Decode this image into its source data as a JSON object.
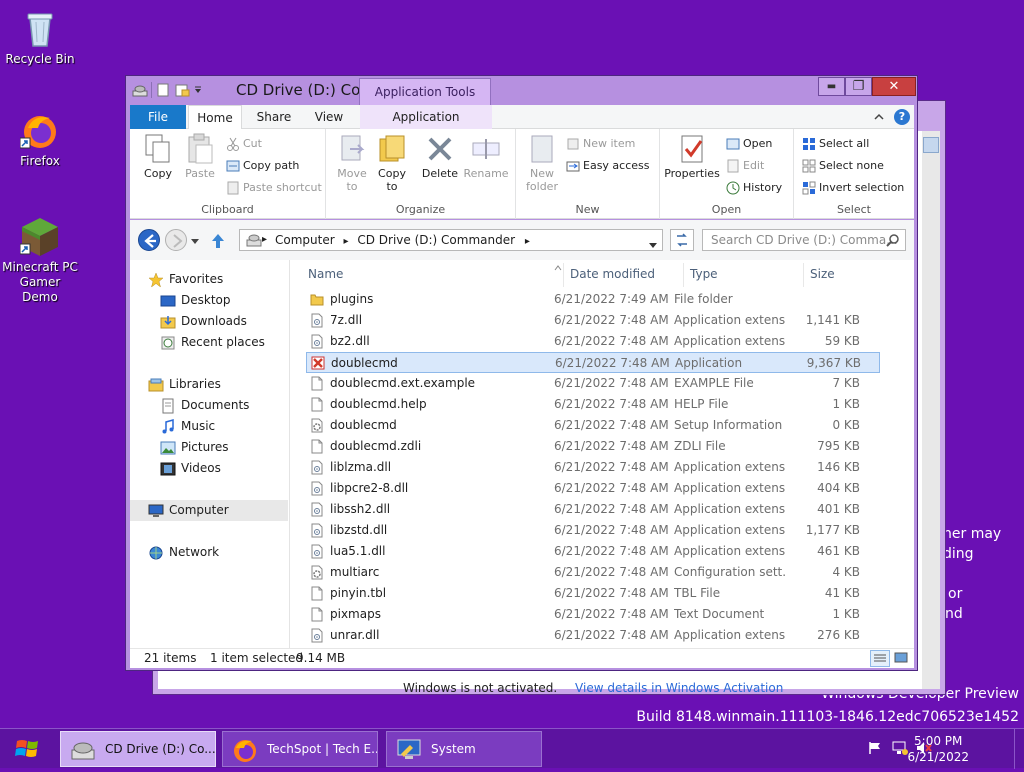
{
  "desktop": {
    "icons": [
      {
        "label": "Recycle Bin"
      },
      {
        "label": "Firefox"
      },
      {
        "label": "Minecraft PC Gamer Demo"
      }
    ],
    "watermark": {
      "partial_1": "ner may",
      "partial_2": "ding",
      "partial_3": "or",
      "partial_4": "nd",
      "line1": "Windows Developer Preview",
      "line2": "Build 8148.winmain.111103-1846.12edc706523e1452"
    }
  },
  "back_window": {
    "activation_text": "Windows is not activated.",
    "activation_link": "View details in Windows Activation"
  },
  "explorer": {
    "title": "CD Drive (D:) Co...",
    "context_tab": "Application Tools",
    "window_controls": {
      "minimize": "▬",
      "maximize": "❐",
      "close": "✕"
    },
    "tabs": {
      "file": "File",
      "home": "Home",
      "share": "Share",
      "view": "View",
      "application": "Application"
    },
    "ribbon": {
      "clipboard": {
        "label": "Clipboard",
        "copy": "Copy",
        "paste": "Paste",
        "cut": "Cut",
        "copy_path": "Copy path",
        "paste_shortcut": "Paste shortcut"
      },
      "organize": {
        "label": "Organize",
        "move_to": "Move to",
        "copy_to": "Copy to",
        "delete": "Delete",
        "rename": "Rename"
      },
      "new": {
        "label": "New",
        "new_folder": "New folder",
        "new_item": "New item",
        "easy_access": "Easy access"
      },
      "open": {
        "label": "Open",
        "properties": "Properties",
        "open": "Open",
        "edit": "Edit",
        "history": "History"
      },
      "select": {
        "label": "Select",
        "select_all": "Select all",
        "select_none": "Select none",
        "invert_selection": "Invert selection"
      }
    },
    "address": {
      "crumb1": "Computer",
      "crumb2": "CD Drive (D:) Commander",
      "search_placeholder": "Search CD Drive (D:) Comma..."
    },
    "nav": {
      "favorites": "Favorites",
      "desktop": "Desktop",
      "downloads": "Downloads",
      "recent_places": "Recent places",
      "libraries": "Libraries",
      "documents": "Documents",
      "music": "Music",
      "pictures": "Pictures",
      "videos": "Videos",
      "computer": "Computer",
      "network": "Network"
    },
    "columns": {
      "name": "Name",
      "date": "Date modified",
      "type": "Type",
      "size": "Size"
    },
    "files": [
      {
        "name": "plugins",
        "date": "6/21/2022 7:49 AM",
        "type": "File folder",
        "size": "",
        "icon": "folder-icon"
      },
      {
        "name": "7z.dll",
        "date": "6/21/2022 7:48 AM",
        "type": "Application extens...",
        "size": "1,141 KB",
        "icon": "dll-icon"
      },
      {
        "name": "bz2.dll",
        "date": "6/21/2022 7:48 AM",
        "type": "Application extens...",
        "size": "59 KB",
        "icon": "dll-icon"
      },
      {
        "name": "doublecmd",
        "date": "6/21/2022 7:48 AM",
        "type": "Application",
        "size": "9,367 KB",
        "icon": "app-icon"
      },
      {
        "name": "doublecmd.ext.example",
        "date": "6/21/2022 7:48 AM",
        "type": "EXAMPLE File",
        "size": "7 KB",
        "icon": "file-icon"
      },
      {
        "name": "doublecmd.help",
        "date": "6/21/2022 7:48 AM",
        "type": "HELP File",
        "size": "1 KB",
        "icon": "file-icon"
      },
      {
        "name": "doublecmd",
        "date": "6/21/2022 7:48 AM",
        "type": "Setup Information",
        "size": "0 KB",
        "icon": "settings-file-icon"
      },
      {
        "name": "doublecmd.zdli",
        "date": "6/21/2022 7:48 AM",
        "type": "ZDLI File",
        "size": "795 KB",
        "icon": "file-icon"
      },
      {
        "name": "liblzma.dll",
        "date": "6/21/2022 7:48 AM",
        "type": "Application extens...",
        "size": "146 KB",
        "icon": "dll-icon"
      },
      {
        "name": "libpcre2-8.dll",
        "date": "6/21/2022 7:48 AM",
        "type": "Application extens...",
        "size": "404 KB",
        "icon": "dll-icon"
      },
      {
        "name": "libssh2.dll",
        "date": "6/21/2022 7:48 AM",
        "type": "Application extens...",
        "size": "401 KB",
        "icon": "dll-icon"
      },
      {
        "name": "libzstd.dll",
        "date": "6/21/2022 7:48 AM",
        "type": "Application extens...",
        "size": "1,177 KB",
        "icon": "dll-icon"
      },
      {
        "name": "lua5.1.dll",
        "date": "6/21/2022 7:48 AM",
        "type": "Application extens...",
        "size": "461 KB",
        "icon": "dll-icon"
      },
      {
        "name": "multiarc",
        "date": "6/21/2022 7:48 AM",
        "type": "Configuration sett...",
        "size": "4 KB",
        "icon": "settings-file-icon"
      },
      {
        "name": "pinyin.tbl",
        "date": "6/21/2022 7:48 AM",
        "type": "TBL File",
        "size": "41 KB",
        "icon": "file-icon"
      },
      {
        "name": "pixmaps",
        "date": "6/21/2022 7:48 AM",
        "type": "Text Document",
        "size": "1 KB",
        "icon": "file-icon"
      },
      {
        "name": "unrar.dll",
        "date": "6/21/2022 7:48 AM",
        "type": "Application extens...",
        "size": "276 KB",
        "icon": "dll-icon"
      }
    ],
    "selected_index": 3,
    "status": {
      "count": "21 items",
      "selection": "1 item selected",
      "size": "9.14 MB"
    }
  },
  "taskbar": {
    "items": [
      {
        "label": "CD Drive (D:) Co..."
      },
      {
        "label": "TechSpot | Tech E..."
      },
      {
        "label": "System"
      }
    ],
    "time": "5:00 PM",
    "date": "6/21/2022"
  },
  "colors": {
    "desktop": "#6a10b4",
    "window_frame": "#b690e0",
    "file_tab": "#1979ca",
    "selection": "#d9e8fb"
  }
}
